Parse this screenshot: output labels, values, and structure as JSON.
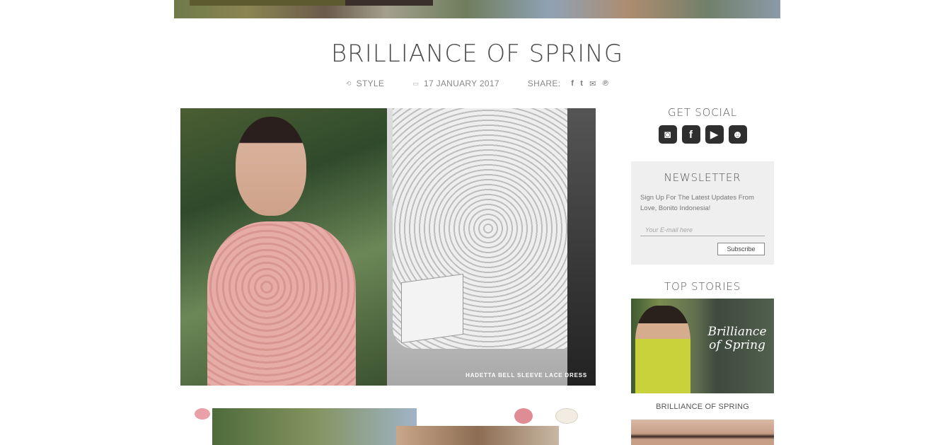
{
  "post": {
    "title": "BRILLIANCE OF SPRING",
    "category": "STYLE",
    "date": "17 JANUARY 2017",
    "share_label": "SHARE:",
    "share_icons": [
      "facebook-icon",
      "twitter-icon",
      "email-icon",
      "pinterest-icon"
    ],
    "share_glyphs": {
      "facebook": "f",
      "twitter": "t",
      "email": "✉",
      "pinterest": "℗"
    },
    "hero_caption": "HADETTA BELL SLEEVE LACE DRESS"
  },
  "sidebar": {
    "social_heading": "GET SOCIAL",
    "social_icons": [
      "instagram-icon",
      "facebook-icon",
      "youtube-icon",
      "snapchat-icon"
    ],
    "social_glyphs": {
      "instagram": "◙",
      "facebook": "f",
      "youtube": "▶",
      "snapchat": "☻"
    },
    "newsletter": {
      "heading": "NEWSLETTER",
      "text": "Sign Up For The Latest Updates From Love, Bonito Indonesia!",
      "email_placeholder": "Your E-mail here",
      "button_label": "Subscribe"
    },
    "top_stories": {
      "heading": "TOP STORIES",
      "items": [
        {
          "label": "BRILLIANCE OF SPRING"
        }
      ]
    }
  },
  "colors": {
    "text": "#555555",
    "newsletter_bg": "#efefef",
    "social_icon": "#2f2f2f"
  }
}
